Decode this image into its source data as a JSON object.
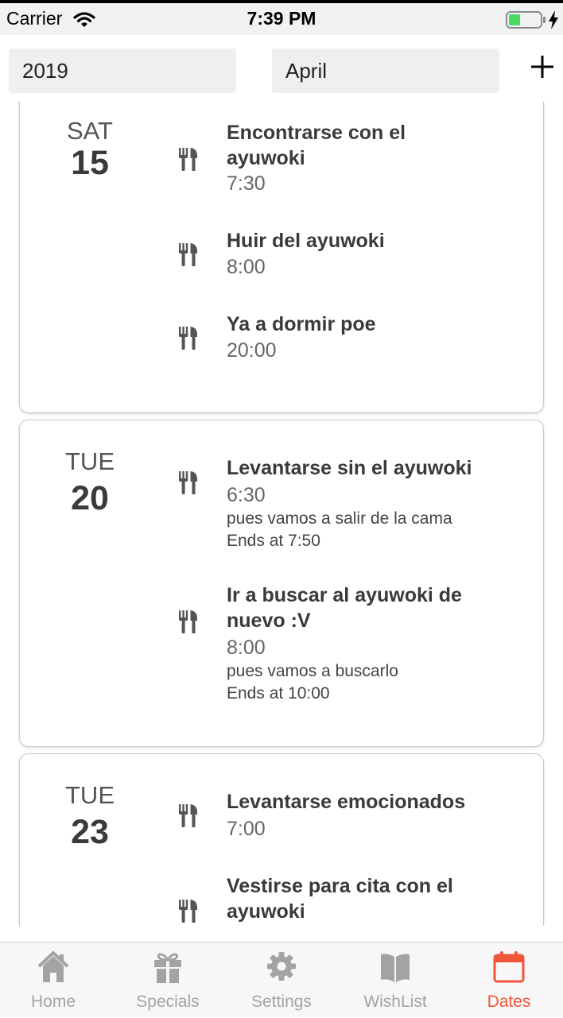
{
  "status": {
    "carrier": "Carrier",
    "time": "7:39 PM"
  },
  "filter": {
    "year": "2019",
    "month": "April"
  },
  "days": [
    {
      "day_name": "SAT",
      "day_num": "15",
      "events": [
        {
          "icon": "utensils-icon",
          "title_lines": [
            "Encontrarse con el",
            "ayuwoki"
          ],
          "time": "7:30"
        },
        {
          "icon": "utensils-icon",
          "title_lines": [
            "Huir del ayuwoki"
          ],
          "time": "8:00"
        },
        {
          "icon": "utensils-icon",
          "title_lines": [
            "Ya a dormir poe"
          ],
          "time": "20:00"
        }
      ]
    },
    {
      "day_name": "TUE",
      "day_num": "20",
      "events": [
        {
          "icon": "utensils-icon",
          "title_lines": [
            "Levantarse sin el ayuwoki"
          ],
          "time": "6:30",
          "description": "pues vamos a salir de la cama",
          "ends": "Ends at 7:50"
        },
        {
          "icon": "utensils-icon",
          "title_lines": [
            "Ir a buscar al ayuwoki de",
            "nuevo :V"
          ],
          "time": "8:00",
          "description": "pues vamos a buscarlo",
          "ends": "Ends at 10:00"
        }
      ]
    },
    {
      "day_name": "TUE",
      "day_num": "23",
      "events": [
        {
          "icon": "utensils-icon",
          "title_lines": [
            "Levantarse emocionados"
          ],
          "time": "7:00"
        },
        {
          "icon": "utensils-icon",
          "title_lines": [
            "Vestirse para cita con el",
            "ayuwoki"
          ]
        }
      ]
    }
  ],
  "tabs": [
    {
      "label": "Home",
      "icon": "home-icon",
      "active": false
    },
    {
      "label": "Specials",
      "icon": "gift-icon",
      "active": false
    },
    {
      "label": "Settings",
      "icon": "gear-icon",
      "active": false
    },
    {
      "label": "WishList",
      "icon": "book-icon",
      "active": false
    },
    {
      "label": "Dates",
      "icon": "calendar-icon",
      "active": true
    }
  ],
  "colors": {
    "accent": "#f0553a",
    "inactive_tab": "#a3a3a3",
    "icon": "#555555"
  }
}
